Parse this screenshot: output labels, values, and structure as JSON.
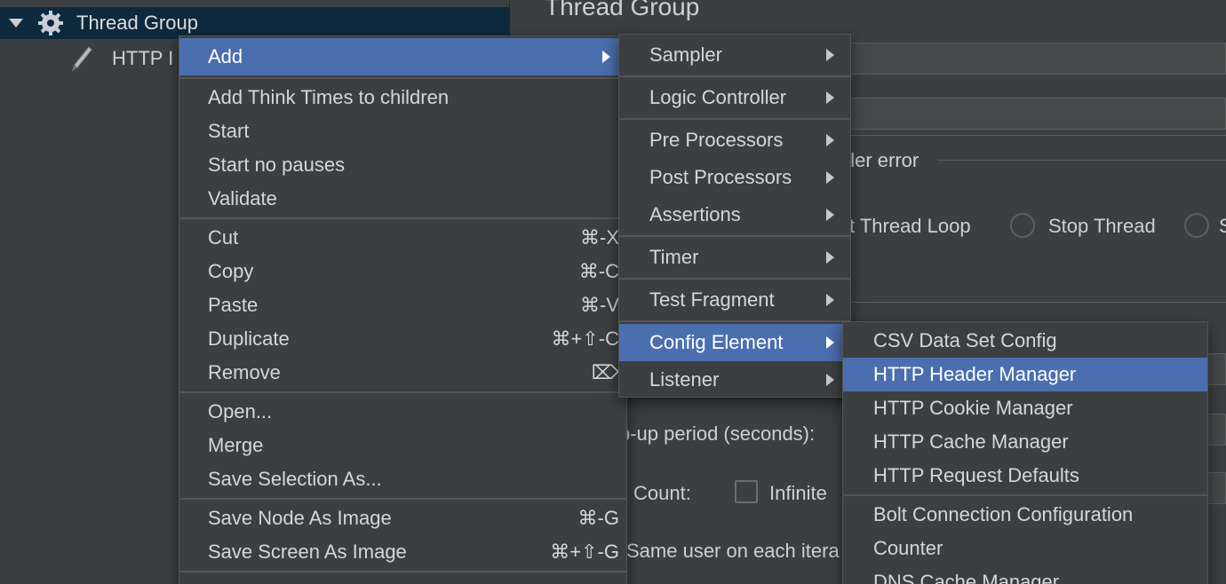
{
  "tree": {
    "thread_group": "Thread Group",
    "http_item": "HTTP I"
  },
  "main": {
    "title": "Thread Group",
    "sampler_error_label": "pler error",
    "next_thread_loop": "xt Thread Loop",
    "stop_thread": "Stop Thread",
    "partial_s": "S",
    "rampup_label": "p-up period (seconds):",
    "loop_count_label": "Count:",
    "infinite_label": "Infinite",
    "same_user_label": "Same user on each itera"
  },
  "context_menu": {
    "items": [
      {
        "label": "Add",
        "shortcut": "",
        "submenu": true,
        "selected": true
      },
      {
        "label": "Add Think Times to children",
        "shortcut": ""
      },
      {
        "label": "Start",
        "shortcut": ""
      },
      {
        "label": "Start no pauses",
        "shortcut": ""
      },
      {
        "label": "Validate",
        "shortcut": ""
      },
      {
        "label": "Cut",
        "shortcut": "⌘-X"
      },
      {
        "label": "Copy",
        "shortcut": "⌘-C"
      },
      {
        "label": "Paste",
        "shortcut": "⌘-V"
      },
      {
        "label": "Duplicate",
        "shortcut": "⌘+⇧-C"
      },
      {
        "label": "Remove",
        "shortcut": "⌦"
      },
      {
        "label": "Open...",
        "shortcut": ""
      },
      {
        "label": "Merge",
        "shortcut": ""
      },
      {
        "label": "Save Selection As...",
        "shortcut": ""
      },
      {
        "label": "Save Node As Image",
        "shortcut": "⌘-G"
      },
      {
        "label": "Save Screen As Image",
        "shortcut": "⌘+⇧-G"
      }
    ]
  },
  "add_submenu": {
    "items": [
      {
        "label": "Sampler"
      },
      {
        "label": "Logic Controller"
      },
      {
        "label": "Pre Processors"
      },
      {
        "label": "Post Processors"
      },
      {
        "label": "Assertions"
      },
      {
        "label": "Timer"
      },
      {
        "label": "Test Fragment"
      },
      {
        "label": "Config Element",
        "selected": true
      },
      {
        "label": "Listener"
      }
    ]
  },
  "config_submenu": {
    "items": [
      {
        "label": "CSV Data Set Config"
      },
      {
        "label": "HTTP Header Manager",
        "selected": true
      },
      {
        "label": "HTTP Cookie Manager"
      },
      {
        "label": "HTTP Cache Manager"
      },
      {
        "label": "HTTP Request Defaults"
      },
      {
        "label": "Bolt Connection Configuration"
      },
      {
        "label": "Counter"
      },
      {
        "label": "DNS Cache Manager"
      }
    ]
  },
  "colors": {
    "background": "#3c3f41",
    "selection": "#4b6eaf",
    "tree_selection": "#0d293e",
    "text": "#d6d6d6"
  }
}
